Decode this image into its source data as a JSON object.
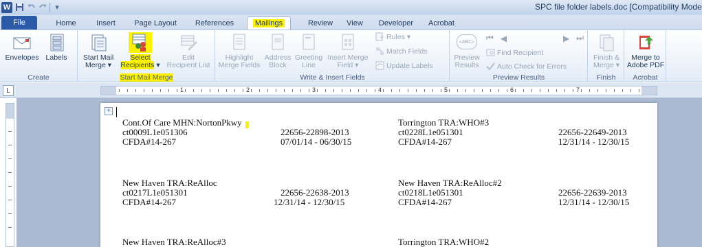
{
  "window": {
    "title": "SPC file folder labels.doc [Compatibility Mode]",
    "app_logo": "W"
  },
  "quick_access": {
    "icons": [
      "save-icon",
      "undo-icon",
      "redo-icon",
      "customize-icon"
    ]
  },
  "tabs": [
    {
      "label": "File",
      "state": "file"
    },
    {
      "label": "Home"
    },
    {
      "label": "Insert"
    },
    {
      "label": "Page Layout"
    },
    {
      "label": "References"
    },
    {
      "label": "Mailings",
      "state": "active"
    },
    {
      "label": "Review"
    },
    {
      "label": "View"
    },
    {
      "label": "Developer"
    },
    {
      "label": "Acrobat"
    }
  ],
  "ribbon": {
    "create": {
      "label": "Create",
      "envelopes": "Envelopes",
      "labels": "Labels"
    },
    "start_mail_merge": {
      "label": "Start Mail Merge",
      "start_line1": "Start Mail",
      "start_line2": "Merge",
      "select_line1": "Select",
      "select_line2": "Recipients",
      "edit_line1": "Edit",
      "edit_line2": "Recipient List"
    },
    "write_insert": {
      "label": "Write & Insert Fields",
      "highlight_line1": "Highlight",
      "highlight_line2": "Merge Fields",
      "address_line1": "Address",
      "address_line2": "Block",
      "greeting_line1": "Greeting",
      "greeting_line2": "Line",
      "insert_line1": "Insert Merge",
      "insert_line2": "Field",
      "rules": "Rules",
      "match_fields": "Match Fields",
      "update_labels": "Update Labels"
    },
    "preview": {
      "label": "Preview Results",
      "preview_line1": "Preview",
      "preview_line2": "Results",
      "abc_glyph": "«ABC»",
      "find_recipient": "Find Recipient",
      "auto_check": "Auto Check for Errors"
    },
    "finish": {
      "label": "Finish",
      "finish_line1": "Finish &",
      "finish_line2": "Merge"
    },
    "acrobat": {
      "label": "Acrobat",
      "merge_line1": "Merge to",
      "merge_line2": "Adobe PDF"
    }
  },
  "ruler": {
    "numbers": [
      "1",
      "2",
      "3",
      "4",
      "5",
      "6",
      "7"
    ],
    "corner_glyph": "L"
  },
  "document": {
    "table_handle_glyph": "+",
    "labels": [
      {
        "line1": "Cont.Of Care MHN:NortonPkwy",
        "line2_left": "ct0009L1e051306",
        "line2_right": "22656-22898-2013",
        "line3_left": "CFDA#14-267",
        "line3_right": "07/01/14 - 06/30/15"
      },
      {
        "line1": "Torrington TRA:WHO#3",
        "line2_left": "ct0228L1e051301",
        "line2_right": "22656-22649-2013",
        "line3_left": "CFDA#14-267",
        "line3_right": "12/31/14 - 12/30/15"
      },
      {
        "line1": "New Haven TRA:ReAlloc",
        "line2_left": "ct0217L1e051301",
        "line2_right": "22656-22638-2013",
        "line3_left": "CFDA#14-267",
        "line3_right": "12/31/14 - 12/30/15"
      },
      {
        "line1": "New Haven TRA:ReAlloc#2",
        "line2_left": "ct0218L1e051301",
        "line2_right": "22656-22639-2013",
        "line3_left": "CFDA#14-267",
        "line3_right": "12/31/14 - 12/30/15"
      },
      {
        "line1": "New Haven TRA:ReAlloc#3"
      },
      {
        "line1": "Torrington TRA:WHO#2"
      }
    ]
  }
}
